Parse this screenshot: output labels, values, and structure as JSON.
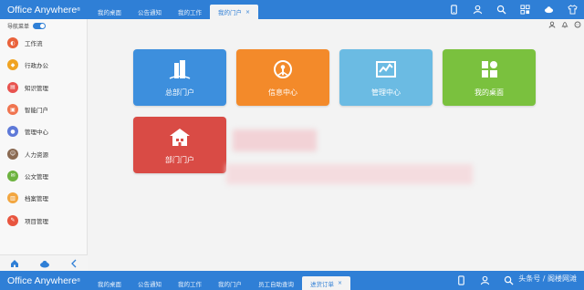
{
  "app": {
    "title": "Office Anywhere",
    "mark": "®"
  },
  "tabs": [
    {
      "label": "我的桌面"
    },
    {
      "label": "公告通知"
    },
    {
      "label": "我的工作"
    },
    {
      "label": "我的门户",
      "active": true,
      "close": "×"
    }
  ],
  "top_icons": [
    "mobile-icon",
    "user-icon",
    "search-icon",
    "apps-icon",
    "cloud-icon",
    "shirt-icon"
  ],
  "sidebar": {
    "toggle_label": "导航菜单",
    "items": [
      {
        "label": "工作流",
        "color": "#e9623b"
      },
      {
        "label": "行政办公",
        "color": "#f0a322"
      },
      {
        "label": "知识管理",
        "color": "#e8534f"
      },
      {
        "label": "智能门户",
        "color": "#f0744f"
      },
      {
        "label": "管理中心",
        "color": "#5e79d8"
      },
      {
        "label": "人力资源",
        "color": "#f08b3a"
      },
      {
        "label": "公文管理",
        "color": "#6db33f"
      },
      {
        "label": "档案管理",
        "color": "#f2a640"
      },
      {
        "label": "项目管理",
        "color": "#e8553f"
      }
    ]
  },
  "right_tools": [
    "contacts-icon",
    "bell-icon",
    "chat-icon"
  ],
  "tiles": [
    {
      "label": "总部门户",
      "color": "#3d8fdd",
      "icon": "building-icon"
    },
    {
      "label": "信息中心",
      "color": "#f38a2a",
      "icon": "info-center-icon"
    },
    {
      "label": "管理中心",
      "color": "#6bbbe3",
      "icon": "chart-icon"
    },
    {
      "label": "我的桌面",
      "color": "#7ac13e",
      "icon": "desktop-icon"
    },
    {
      "label": "部门门户",
      "color": "#d94b45",
      "icon": "department-icon"
    }
  ],
  "bottom_tabs": [
    {
      "label": "我的桌面"
    },
    {
      "label": "公告通知"
    },
    {
      "label": "我的工作"
    },
    {
      "label": "我的门户"
    },
    {
      "label": "员工自助查询"
    },
    {
      "label": "进货订单",
      "active": true,
      "close": "×"
    }
  ],
  "watermark": "头条号 / 阁楼网滩"
}
